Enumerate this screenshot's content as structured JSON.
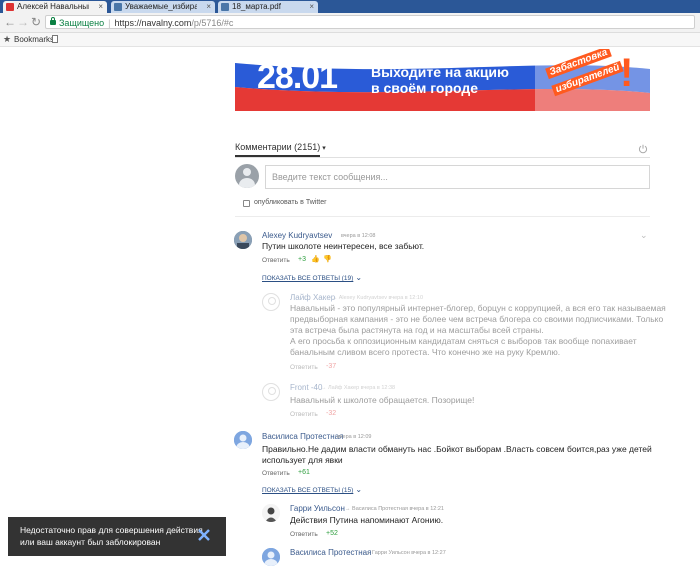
{
  "browser": {
    "tabs": [
      {
        "label": "Алексей Навальный — ",
        "active": true,
        "favicon_color": "#d33"
      },
      {
        "label": "Уважаемые_избира... (1",
        "active": false,
        "favicon_color": "#4a76a8",
        "favicon_text": "vk"
      },
      {
        "label": "18_марта.pdf",
        "active": false,
        "favicon_color": "#4a76a8",
        "favicon_text": "vk"
      }
    ],
    "tab_close": "×",
    "secure_label": "Защищено",
    "url_host": "https://navalny.com",
    "url_path": "/p/5716/#c",
    "bookmarks_label": "Bookmarks"
  },
  "banner": {
    "date": "28.01",
    "line1": "Выходите на акцию",
    "line2": "в своём городе",
    "badge1": "Забастовка",
    "badge2": "избирателей",
    "excl": "!"
  },
  "comments": {
    "tab_label": "Комментарии (2151)",
    "caret": "▾",
    "input_placeholder": "Введите текст сообщения...",
    "twitter_label": "опубликовать в Twitter",
    "reply_label": "Ответить",
    "items": [
      {
        "name": "Alexey Kudryavtsev",
        "meta": "вчера в 12:08",
        "text": "Путин школоте неинтересен, все забьют.",
        "score": "+3",
        "show_all": "ПОКАЗАТЬ ВСЕ ОТВЕТЫ (19)"
      },
      {
        "name": "Лайф Хакер",
        "meta": "→ Alexey Kudryavtsev вчера в 12:10",
        "lines": [
          "Навальный - это популярный интернет-блогер, борцун с коррупцией, а вся его так называемая",
          "предвыборная кампания - это не более чем встреча блогера со своими подписчиками. Только",
          "эта встреча была растянута на год и на масштабы всей страны.",
          "А его просьба к оппозиционным кандидатам сняться с выборов так вообще попахивает",
          "банальным сливом всего протеста. Что конечно же на руку Кремлю."
        ],
        "score": "-37"
      },
      {
        "name": "Front -40",
        "meta": "→ Лайф Хакер вчера в 12:38",
        "text": "Навальный к школоте обращается. Позорище!",
        "score": "-32"
      },
      {
        "name": "Василиса Протестная",
        "meta": "вчера в 12:09",
        "lines": [
          "Правильно.Не дадим власти обмануть нас .Бойкот выборам .Власть совсем боится,раз уже детей",
          "использует для явки"
        ],
        "score": "+61",
        "show_all": "ПОКАЗАТЬ ВСЕ ОТВЕТЫ (15)"
      },
      {
        "name": "Гарри Уильсон",
        "meta": "→ Василиса Протестная вчера в 12:21",
        "text": "Действия Путина напоминают Агонию.",
        "score": "+52"
      },
      {
        "name": "Василиса Протестная",
        "meta": "→ Гарри Уильсон вчера в 12:27"
      }
    ]
  },
  "toast": {
    "line1": "Недостаточно прав для совершения действия",
    "line2": "или ваш аккаунт был заблокирован"
  },
  "colors": {
    "tabbar": "#2b5797",
    "link": "#3a5a8c",
    "positive": "#2e9e3e",
    "negative": "#d33",
    "toast_bg": "#333333",
    "banner_orange": "#ff5a1f"
  }
}
